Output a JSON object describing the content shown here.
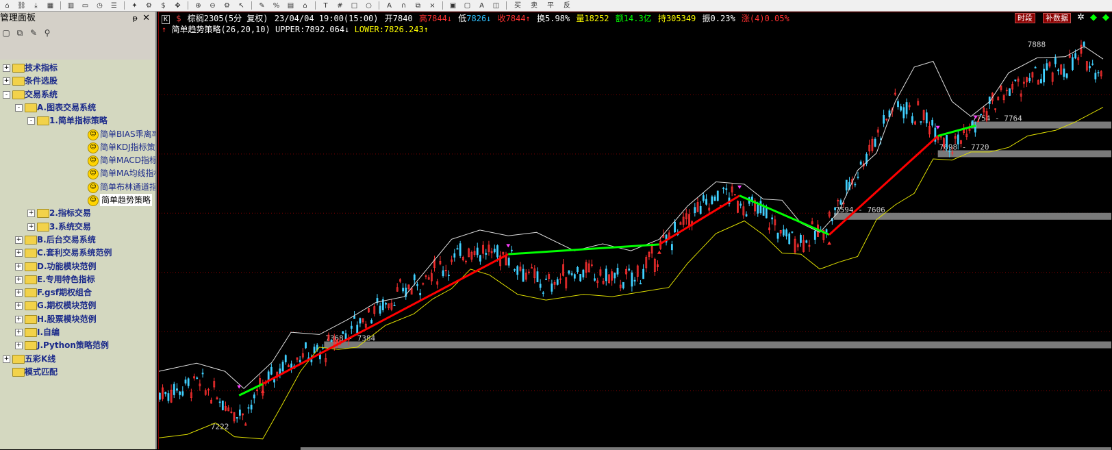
{
  "toolbar": {
    "icons": [
      "home-icon",
      "link-icon",
      "download-icon",
      "grid-icon",
      "chart-bars-icon",
      "screen-icon",
      "clock-icon",
      "list-icon",
      "star-icon",
      "gear-icon",
      "dollar-icon",
      "crosshair-icon",
      "zoom-in-icon",
      "zoom-out-icon",
      "settings-icon",
      "cursor-icon",
      "pen-icon",
      "percent-icon",
      "ruler-icon",
      "marker-icon",
      "text-icon",
      "grid2-icon",
      "rect-icon",
      "circle-icon",
      "a-icon",
      "lock-icon",
      "copy-icon",
      "x-icon",
      "paste-icon",
      "save-icon",
      "color-icon",
      "clone-icon"
    ],
    "tail_labels": [
      "买",
      "卖",
      "平",
      "反"
    ]
  },
  "panel": {
    "title": "管理面板",
    "pin": "ᵽ",
    "close": "✕",
    "tree": [
      {
        "label": "技术指标",
        "level": 0,
        "expander": "+",
        "type": "folder"
      },
      {
        "label": "条件选股",
        "level": 0,
        "expander": "+",
        "type": "folder"
      },
      {
        "label": "交易系统",
        "level": 0,
        "expander": "-",
        "type": "folder"
      },
      {
        "label": "A.图表交易系统",
        "level": 1,
        "expander": "-",
        "type": "folder"
      },
      {
        "label": "1.简单指标策略",
        "level": 2,
        "expander": "-",
        "type": "folder"
      },
      {
        "label": "简单BIAS乖离率指标策略",
        "level": 3,
        "type": "leaf"
      },
      {
        "label": "简单KDJ指标策略(多头)",
        "level": 3,
        "type": "leaf"
      },
      {
        "label": "简单MACD指标策略",
        "level": 3,
        "type": "leaf"
      },
      {
        "label": "简单MA均线指标策略",
        "level": 3,
        "type": "leaf"
      },
      {
        "label": "简单布林通道指标策略",
        "level": 3,
        "type": "leaf"
      },
      {
        "label": "简单趋势策略",
        "level": 3,
        "type": "leaf",
        "selected": true
      },
      {
        "label": "2.指标交易",
        "level": 2,
        "expander": "+",
        "type": "folder"
      },
      {
        "label": "3.系统交易",
        "level": 2,
        "expander": "+",
        "type": "folder"
      },
      {
        "label": "B.后台交易系统",
        "level": 1,
        "expander": "+",
        "type": "folder"
      },
      {
        "label": "C.套利交易系统范例",
        "level": 1,
        "expander": "+",
        "type": "folder"
      },
      {
        "label": "D.功能模块范例",
        "level": 1,
        "expander": "+",
        "type": "folder"
      },
      {
        "label": "E.专用特色指标",
        "level": 1,
        "expander": "+",
        "type": "folder"
      },
      {
        "label": "F.gsf期权组合",
        "level": 1,
        "expander": "+",
        "type": "folder"
      },
      {
        "label": "G.期权模块范例",
        "level": 1,
        "expander": "+",
        "type": "folder"
      },
      {
        "label": "H.股票模块范例",
        "level": 1,
        "expander": "+",
        "type": "folder"
      },
      {
        "label": "I.自编",
        "level": 1,
        "expander": "+",
        "type": "folder"
      },
      {
        "label": "J.Python策略范例",
        "level": 1,
        "expander": "+",
        "type": "folder"
      },
      {
        "label": "五彩K线",
        "level": 0,
        "expander": "+",
        "type": "folder"
      },
      {
        "label": "模式匹配",
        "level": 0,
        "type": "folder"
      }
    ]
  },
  "info": {
    "symbol": "棕榈2305(5分 复权)",
    "datetime": "23/04/04 19:00(15:00)",
    "open_label": "开",
    "open": "7840",
    "high_label": "高",
    "high": "7844↓",
    "low_label": "低",
    "low": "7826↓",
    "close_label": "收",
    "close": "7844↑",
    "turnover_label": "换",
    "turnover": "5.98%",
    "volume_label": "量",
    "volume": "18252",
    "amount_label": "额",
    "amount": "14.3亿",
    "oi_label": "持",
    "oi": "305349",
    "amp_label": "振",
    "amp": "0.23%",
    "chg_label": "涨",
    "chg": "(4)0.05%",
    "colors": {
      "open": "#ffffff",
      "up": "#ff3030",
      "down": "#30c0ff",
      "label": "#ffff00",
      "vol": "#ffff00",
      "oi": "#ffff00",
      "amt": "#00ff00"
    }
  },
  "strategy": {
    "name": "简单趋势策略(26,20,10)",
    "upper_label": "UPPER:",
    "upper": "7892.064↓",
    "lower_label": "LOWER:",
    "lower": "7826.243↑"
  },
  "buttons": {
    "period": "时段",
    "supplement": "补数据"
  },
  "chart_data": {
    "type": "candlestick",
    "y_range": [
      7200,
      7910
    ],
    "price_levels": [
      {
        "label": "7888",
        "price": 7888
      },
      {
        "label": "7754 - 7764",
        "price": 7759
      },
      {
        "label": "7698 - 7720",
        "price": 7709
      },
      {
        "label": "7594 - 7606",
        "price": 7600
      },
      {
        "label": "7368 - 7384",
        "price": 7376
      },
      {
        "label": "7222",
        "price": 7222
      }
    ],
    "trend_segments": [
      {
        "from": [
          0.085,
          7288
        ],
        "to": [
          0.11,
          7308
        ],
        "color": "#00ff00"
      },
      {
        "from": [
          0.11,
          7308
        ],
        "to": [
          0.37,
          7534
        ],
        "color": "#ff0000"
      },
      {
        "from": [
          0.37,
          7534
        ],
        "to": [
          0.53,
          7551
        ],
        "color": "#00ff00"
      },
      {
        "from": [
          0.53,
          7551
        ],
        "to": [
          0.615,
          7636
        ],
        "color": "#ff0000"
      },
      {
        "from": [
          0.615,
          7636
        ],
        "to": [
          0.71,
          7568
        ],
        "color": "#00ff00"
      },
      {
        "from": [
          0.71,
          7568
        ],
        "to": [
          0.825,
          7740
        ],
        "color": "#ff0000"
      },
      {
        "from": [
          0.825,
          7740
        ],
        "to": [
          0.865,
          7758
        ],
        "color": "#00ff00"
      }
    ],
    "upper_band": [
      [
        0,
        7330
      ],
      [
        0.04,
        7344
      ],
      [
        0.07,
        7330
      ],
      [
        0.09,
        7300
      ],
      [
        0.12,
        7346
      ],
      [
        0.14,
        7398
      ],
      [
        0.17,
        7394
      ],
      [
        0.2,
        7420
      ],
      [
        0.23,
        7450
      ],
      [
        0.26,
        7460
      ],
      [
        0.29,
        7520
      ],
      [
        0.31,
        7560
      ],
      [
        0.34,
        7576
      ],
      [
        0.37,
        7566
      ],
      [
        0.4,
        7572
      ],
      [
        0.44,
        7540
      ],
      [
        0.47,
        7552
      ],
      [
        0.5,
        7540
      ],
      [
        0.53,
        7560
      ],
      [
        0.56,
        7618
      ],
      [
        0.59,
        7660
      ],
      [
        0.62,
        7656
      ],
      [
        0.64,
        7630
      ],
      [
        0.66,
        7628
      ],
      [
        0.68,
        7588
      ],
      [
        0.7,
        7572
      ],
      [
        0.72,
        7608
      ],
      [
        0.74,
        7680
      ],
      [
        0.76,
        7710
      ],
      [
        0.78,
        7800
      ],
      [
        0.8,
        7860
      ],
      [
        0.82,
        7870
      ],
      [
        0.84,
        7800
      ],
      [
        0.86,
        7774
      ],
      [
        0.88,
        7800
      ],
      [
        0.9,
        7850
      ],
      [
        0.93,
        7876
      ],
      [
        0.96,
        7878
      ],
      [
        0.98,
        7896
      ],
      [
        1,
        7874
      ]
    ],
    "lower_band": [
      [
        0,
        7214
      ],
      [
        0.03,
        7220
      ],
      [
        0.06,
        7240
      ],
      [
        0.08,
        7216
      ],
      [
        0.11,
        7212
      ],
      [
        0.13,
        7270
      ],
      [
        0.15,
        7330
      ],
      [
        0.17,
        7372
      ],
      [
        0.19,
        7368
      ],
      [
        0.21,
        7372
      ],
      [
        0.24,
        7410
      ],
      [
        0.27,
        7430
      ],
      [
        0.29,
        7456
      ],
      [
        0.31,
        7474
      ],
      [
        0.33,
        7508
      ],
      [
        0.35,
        7498
      ],
      [
        0.38,
        7464
      ],
      [
        0.41,
        7454
      ],
      [
        0.45,
        7464
      ],
      [
        0.48,
        7460
      ],
      [
        0.51,
        7468
      ],
      [
        0.54,
        7476
      ],
      [
        0.56,
        7518
      ],
      [
        0.59,
        7570
      ],
      [
        0.62,
        7592
      ],
      [
        0.64,
        7568
      ],
      [
        0.66,
        7536
      ],
      [
        0.68,
        7534
      ],
      [
        0.7,
        7508
      ],
      [
        0.72,
        7520
      ],
      [
        0.74,
        7530
      ],
      [
        0.76,
        7594
      ],
      [
        0.78,
        7620
      ],
      [
        0.8,
        7640
      ],
      [
        0.82,
        7700
      ],
      [
        0.84,
        7698
      ],
      [
        0.86,
        7712
      ],
      [
        0.88,
        7712
      ],
      [
        0.9,
        7720
      ],
      [
        0.92,
        7740
      ],
      [
        0.95,
        7750
      ],
      [
        0.97,
        7764
      ],
      [
        1,
        7790
      ]
    ],
    "signals": [
      {
        "x": 0.085,
        "y": 7296,
        "dir": "down"
      },
      {
        "x": 0.11,
        "y": 7302,
        "dir": "up"
      },
      {
        "x": 0.37,
        "y": 7542,
        "dir": "down"
      },
      {
        "x": 0.53,
        "y": 7544,
        "dir": "up"
      },
      {
        "x": 0.615,
        "y": 7644,
        "dir": "down"
      },
      {
        "x": 0.71,
        "y": 7560,
        "dir": "up"
      },
      {
        "x": 0.825,
        "y": 7748,
        "dir": "down"
      },
      {
        "x": 0.865,
        "y": 7766,
        "dir": "down"
      }
    ],
    "candles_path": [
      [
        0,
        7290
      ],
      [
        0.04,
        7310
      ],
      [
        0.07,
        7276
      ],
      [
        0.09,
        7254
      ],
      [
        0.11,
        7300
      ],
      [
        0.13,
        7340
      ],
      [
        0.15,
        7360
      ],
      [
        0.17,
        7358
      ],
      [
        0.2,
        7400
      ],
      [
        0.23,
        7440
      ],
      [
        0.26,
        7470
      ],
      [
        0.29,
        7500
      ],
      [
        0.31,
        7520
      ],
      [
        0.33,
        7546
      ],
      [
        0.35,
        7534
      ],
      [
        0.37,
        7534
      ],
      [
        0.39,
        7500
      ],
      [
        0.41,
        7478
      ],
      [
        0.44,
        7506
      ],
      [
        0.47,
        7494
      ],
      [
        0.5,
        7488
      ],
      [
        0.52,
        7518
      ],
      [
        0.54,
        7560
      ],
      [
        0.57,
        7610
      ],
      [
        0.6,
        7640
      ],
      [
        0.62,
        7620
      ],
      [
        0.64,
        7606
      ],
      [
        0.66,
        7568
      ],
      [
        0.68,
        7560
      ],
      [
        0.7,
        7570
      ],
      [
        0.72,
        7620
      ],
      [
        0.74,
        7680
      ],
      [
        0.76,
        7740
      ],
      [
        0.78,
        7800
      ],
      [
        0.8,
        7780
      ],
      [
        0.82,
        7760
      ],
      [
        0.84,
        7726
      ],
      [
        0.86,
        7750
      ],
      [
        0.88,
        7790
      ],
      [
        0.9,
        7820
      ],
      [
        0.93,
        7840
      ],
      [
        0.96,
        7860
      ],
      [
        0.98,
        7880
      ],
      [
        1,
        7850
      ]
    ]
  }
}
